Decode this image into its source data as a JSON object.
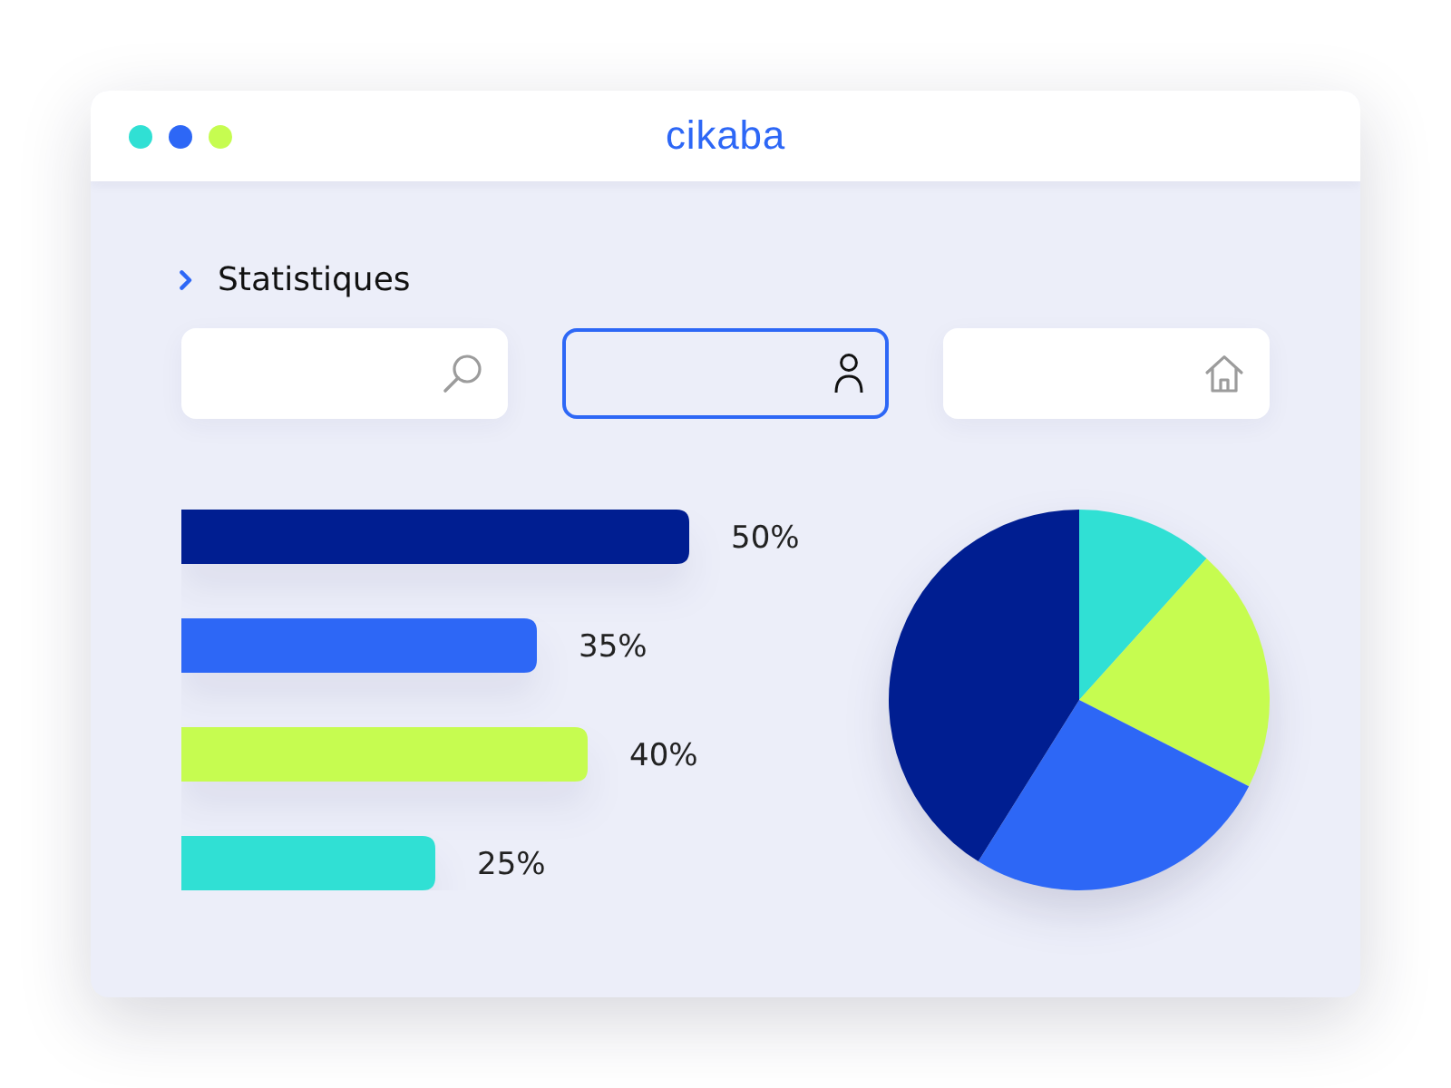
{
  "window": {
    "title": "cikaba"
  },
  "section": {
    "title": "Statistiques"
  },
  "fields": [
    {
      "focused": false
    },
    {
      "focused": true
    },
    {
      "focused": false
    }
  ],
  "bar_chart": {
    "chart_data": {
      "type": "bar",
      "orientation": "horizontal",
      "values": [
        50,
        35,
        40,
        25
      ],
      "value_labels": [
        "50%",
        "35%",
        "40%",
        "25%"
      ],
      "colors": [
        "#001e91",
        "#2d67f6",
        "#c6fc50",
        "#30e0d4"
      ]
    }
  }
}
